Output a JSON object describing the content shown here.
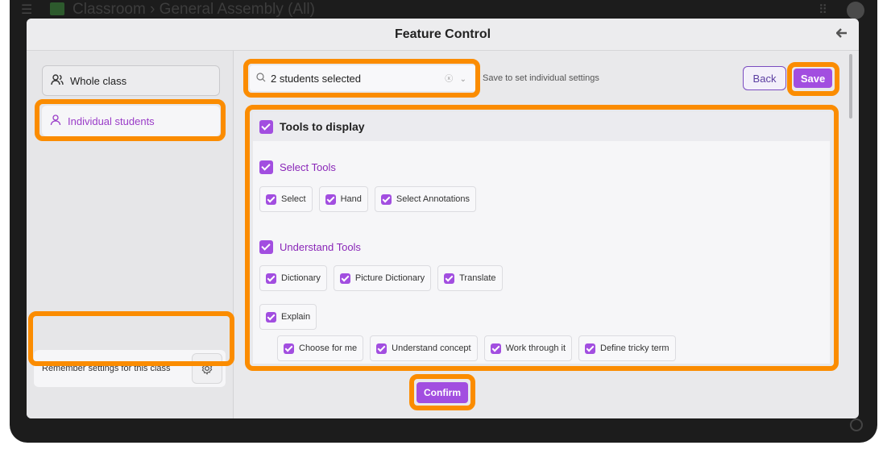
{
  "appbar": {
    "breadcrumb": "Classroom  ›  General Assembly (All)"
  },
  "modal": {
    "title": "Feature Control",
    "back_icon": "arrow-left-icon"
  },
  "sidebar": {
    "whole_class": "Whole class",
    "individual_students": "Individual students",
    "remember": "Remember settings for this class"
  },
  "toolbar": {
    "search_value": "2 students selected",
    "hint": "Save to set individual settings",
    "back_label": "Back",
    "save_label": "Save"
  },
  "tools": {
    "header": "Tools to display",
    "select_group": {
      "title": "Select Tools",
      "items": [
        "Select",
        "Hand",
        "Select Annotations"
      ]
    },
    "understand_group": {
      "title": "Understand Tools",
      "items": [
        "Dictionary",
        "Picture Dictionary",
        "Translate"
      ],
      "explain": "Explain",
      "explain_items": [
        "Choose for me",
        "Understand concept",
        "Work through it",
        "Define tricky term"
      ]
    }
  },
  "footer": {
    "confirm_label": "Confirm"
  },
  "colors": {
    "accent": "#a24ee0",
    "highlight": "#fb8c00",
    "group_title": "#8a27b8"
  }
}
